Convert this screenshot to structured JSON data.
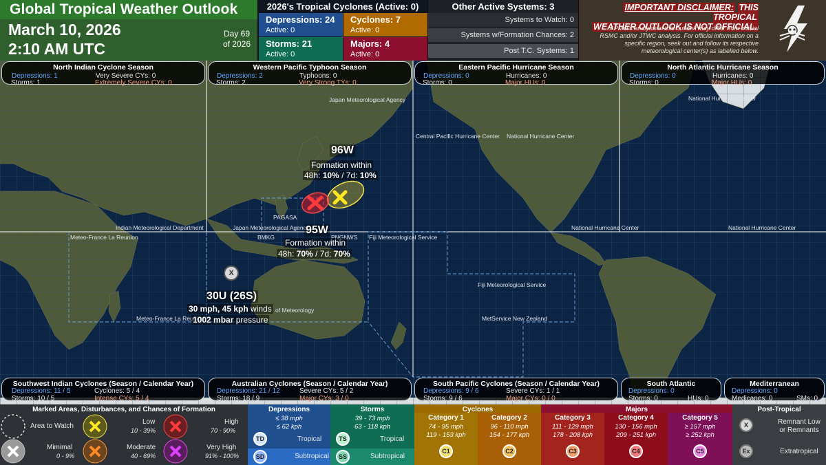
{
  "header": {
    "title": "Global Tropical Weather Outlook",
    "date": "March 10, 2026",
    "time": "2:10 AM UTC",
    "day_line1": "Day 69",
    "day_line2": "of 2026"
  },
  "season_summary": {
    "title": "2026's Tropical Cyclones (Active: 0)",
    "depressions": {
      "label": "Depressions: 24",
      "active": "Active: 0",
      "color": "#1f4f8f"
    },
    "cyclones": {
      "label": "Cyclones: 7",
      "active": "Active: 0",
      "color": "#b06a00"
    },
    "storms": {
      "label": "Storms: 21",
      "active": "Active: 0",
      "color": "#0f6d54"
    },
    "majors": {
      "label": "Majors: 4",
      "active": "Active: 0",
      "color": "#8e1030"
    }
  },
  "other_systems": {
    "title": "Other Active Systems: 3",
    "rows": [
      "Systems to Watch: 0",
      "Systems w/Formation Chances: 2",
      "Post T.C. Systems: 1"
    ]
  },
  "disclaimer": {
    "title_underlined": "IMPORTANT DISCLAIMER:",
    "title_rest1": "THIS TROPICAL",
    "title_rest2": "WEATHER OUTLOOK IS NOT OFFICIAL.",
    "body": "APMet's analysis in this outlook may differ from official RSMC and/or JTWC analysis. For official information on a specific region, seek out and follow its respective meteorological center(s) as labelled below."
  },
  "basins_top": [
    {
      "title": "North Indian Cyclone Season",
      "l1": "Depressions: 1",
      "r1": "Very Severe CYs: 0",
      "l2": "Storms: 1",
      "r2": "Extremely Severe CYs: 0"
    },
    {
      "title": "Western Pacific Typhoon Season",
      "l1": "Depressions: 2",
      "r1": "Typhoons: 0",
      "l2": "Storms: 2",
      "r2": "Very Strong TYs: 0"
    },
    {
      "title": "Eastern Pacific Hurricane Season",
      "l1": "Depressions: 0",
      "r1": "Hurricanes: 0",
      "l2": "Storms: 0",
      "r2": "Major HUs: 0"
    },
    {
      "title": "North Atlantic Hurricane Season",
      "l1": "Depressions: 0",
      "r1": "Hurricanes: 0",
      "l2": "Storms: 0",
      "r2": "Major HUs: 0"
    }
  ],
  "basins_bottom": [
    {
      "title": "Southwest Indian Cyclones (Season / Calendar Year)",
      "l1": "Depressions: 11 / 5",
      "r1": "Cyclones: 5 / 4",
      "l2": "Storms: 10 / 5",
      "r2": "Intense CYs: 5 / 4"
    },
    {
      "title": "Australian Cyclones (Season / Calendar Year)",
      "l1": "Depressions: 21 / 12",
      "r1": "Severe CYs: 5 / 2",
      "l2": "Storms: 18 / 9",
      "r2": "Major CYs: 3 / 0"
    },
    {
      "title": "South Pacific Cyclones (Season / Calendar Year)",
      "l1": "Depressions: 9 / 6",
      "r1": "Severe CYs: 1 / 1",
      "l2": "Storms: 9 / 6",
      "r2": "Major CYs: 0 / 0"
    },
    {
      "title": "South Atlantic",
      "l1": "Depressions: 0",
      "r1": "",
      "l2": "Storms: 0",
      "r2": "HUs: 0"
    },
    {
      "title": "Mediterranean",
      "l1": "Depressions: 0",
      "r1": "",
      "l2": "Medicanes: 0",
      "r2": "SMs: 0"
    }
  ],
  "agencies": [
    "Japan Meteorological Agency",
    "National Hurricane Center",
    "Central Pacific Hurricane Center",
    "National Hurricane Center",
    "Indian Meteorological Department",
    "Japan Meteorological Agency",
    "PAGASA",
    "BMKG",
    "PNGNWS",
    "Fiji Meteorological Service",
    "National Hurricane Center",
    "National Hurricane Center",
    "Meteo-France La Reunion",
    "Fiji Meteorological Service",
    "Meteo-France La Reunion",
    "of Meteorology",
    "MetService New Zealand"
  ],
  "systems": {
    "s96w": {
      "name": "96W",
      "l1": "Formation within",
      "l2a": "48h: ",
      "l2b": "10%",
      "l2c": " / 7d: ",
      "l2d": "10%"
    },
    "s95w": {
      "name": "95W",
      "l1": "Formation within",
      "l2a": "48h: ",
      "l2b": "70%",
      "l2c": " / 7d: ",
      "l2d": "70%"
    },
    "s30u": {
      "name": "30U (26S)",
      "l1a": "30 mph, 45 kph",
      "l1b": " winds",
      "l2a": "1002 mbar",
      "l2b": " pressure",
      "marker": "X"
    }
  },
  "legend": {
    "marked_title": "Marked Areas, Disturbances, and Chances of Formation",
    "watch": "Area to Watch",
    "minimal": "Mimimal",
    "minimal_range": "0 - 9%",
    "low": "Low",
    "low_range": "10 - 39%",
    "moderate": "Moderate",
    "moderate_range": "40 - 69%",
    "high": "High",
    "high_range": "70 - 90%",
    "veryhigh": "Very High",
    "veryhigh_range": "91% - 100%",
    "dep_title": "Depressions",
    "dep_l1": "≤ 38 mph",
    "dep_l2": "≤ 62 kph",
    "storm_title": "Storms",
    "storm_l1": "39 - 73 mph",
    "storm_l2": "63 - 118 kph",
    "td": "TD",
    "sd": "SD",
    "ts": "TS",
    "ss": "SS",
    "tropical": "Tropical",
    "subtropical": "Subtropical",
    "cyc_title": "Cyclones",
    "c1": "Category 1",
    "c1a": "74 - 95 mph",
    "c1b": "119 - 153 kph",
    "c1s": "C1",
    "c2": "Category 2",
    "c2a": "96 - 110 mph",
    "c2b": "154 - 177 kph",
    "c2s": "C2",
    "maj_title": "Majors",
    "c3": "Category 3",
    "c3a": "111 - 129 mph",
    "c3b": "178 - 208 kph",
    "c3s": "C3",
    "c4": "Category 4",
    "c4a": "130 - 156 mph",
    "c4b": "209 - 251 kph",
    "c4s": "C4",
    "c5": "Category 5",
    "c5a": "≥ 157 mph",
    "c5b": "≥ 252 kph",
    "c5s": "C5",
    "pt_title": "Post-Tropical",
    "remnant": "Remnant Low",
    "remnant2": "or Remnants",
    "extra": "Extratropical",
    "ex": "Ex",
    "x": "X"
  }
}
